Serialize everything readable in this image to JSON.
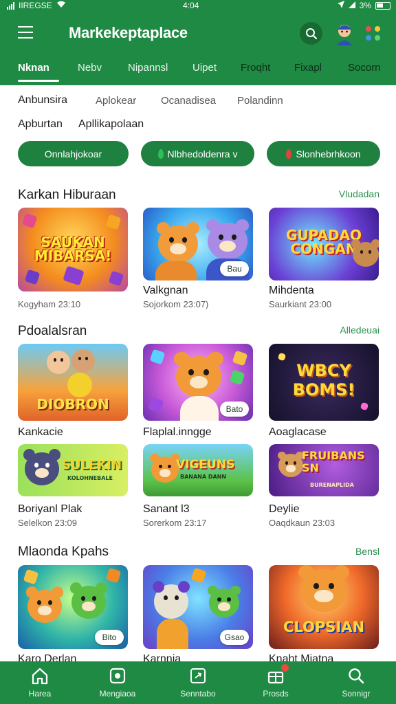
{
  "status_bar": {
    "carrier": "IIREGSE",
    "time": "4:04",
    "battery": "3%"
  },
  "header": {
    "title": "Markekeptaplace"
  },
  "tabs": [
    "Nknan",
    "Nebv",
    "Nipannsl",
    "Uipet",
    "Froqht",
    "Fixapl",
    "Socorn"
  ],
  "filters": {
    "row1": [
      "Anbunsira",
      "Aplokear",
      "Ocanadisea",
      "Polandinn"
    ],
    "row2": [
      "Apburtan",
      "Apllikapolaan"
    ],
    "pills": [
      {
        "label": "Onnlahjokoar",
        "leaf_color": ""
      },
      {
        "label": "Nlbhedoldenra v",
        "leaf_color": "#2fbf58"
      },
      {
        "label": "Slonhebrhkoon",
        "leaf_color": "#e0453c"
      }
    ]
  },
  "sections": [
    {
      "title": "Karkan Hiburaan",
      "link": "Vludadan",
      "cards": [
        {
          "thumb_text": "SAUKAN MIBARSA!",
          "name": "Kogyham 23:10",
          "meta": "",
          "badge": ""
        },
        {
          "thumb_text": "",
          "name": "Valkgnan",
          "meta": "Sojorkom 23:07)",
          "badge": "Bau"
        },
        {
          "thumb_text": "GUPADAO CONGAN",
          "name": "Mihdenta",
          "meta": "Saurkiant 23:00",
          "badge": ""
        }
      ]
    },
    {
      "title": "Pdoalalsran",
      "link": "Alledeuai",
      "cards": [
        {
          "thumb_text": "DIOBRON",
          "name": "Kankacie",
          "meta": "",
          "badge": ""
        },
        {
          "thumb_text": "",
          "name": "Flaplal.inngge",
          "meta": "",
          "badge": "Bato"
        },
        {
          "thumb_text": "WBCY BOMS!",
          "name": "Aoaglacase",
          "meta": "",
          "badge": ""
        },
        {
          "thumb_text": "SULEKIN",
          "thumb_sub": "KOLOHNEBALE",
          "name": "Boriyanl Plak",
          "meta": "Selelkon 23:09",
          "badge": ""
        },
        {
          "thumb_text": "VIGEUNS",
          "thumb_sub": "BANANA DANN",
          "name": "Sanant l3",
          "meta": "Sorerkom 23:17",
          "badge": ""
        },
        {
          "thumb_text": "FRUIBANS SN",
          "thumb_sub": "BURENAPLIDA",
          "name": "Deylie",
          "meta": "Oaqdkaun 23:03",
          "badge": ""
        }
      ]
    },
    {
      "title": "Mlaonda  Kpahs",
      "link": "Bensl",
      "cards": [
        {
          "thumb_text": "",
          "name": "Karo Derlan",
          "meta": "",
          "badge": "Bito"
        },
        {
          "thumb_text": "",
          "name": "Karnnia",
          "meta": "",
          "badge": "Gsao"
        },
        {
          "thumb_text": "CLOPSIAN",
          "name": "Knaht Miatna",
          "meta": "",
          "badge": ""
        }
      ]
    }
  ],
  "bottom_nav": [
    {
      "label": "Harea",
      "icon": "home-icon"
    },
    {
      "label": "Mengiaoa",
      "icon": "games-icon"
    },
    {
      "label": "Senntabo",
      "icon": "apps-icon"
    },
    {
      "label": "Prosds",
      "icon": "gift-icon"
    },
    {
      "label": "Sonnigr",
      "icon": "search-icon"
    }
  ],
  "colors": {
    "primary": "#1f8a43",
    "pill": "#1e8140",
    "link": "#2b8f4f"
  }
}
